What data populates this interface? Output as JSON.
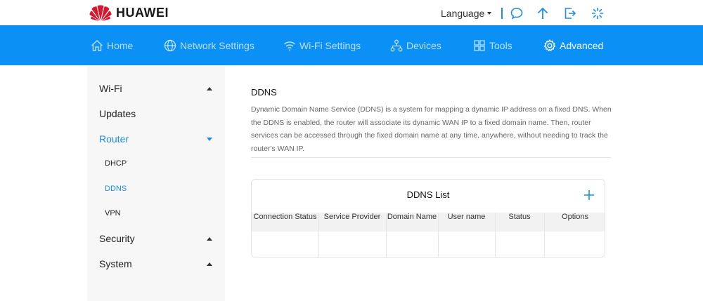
{
  "brand": {
    "name": "HUAWEI",
    "logo_icon": "huawei-petal-logo",
    "accent_color": "#0b90f5",
    "logo_color": "#d9162b"
  },
  "header": {
    "language_label": "Language",
    "icons": [
      "chat-bubble-icon",
      "arrow-up-icon",
      "logout-icon",
      "loading-spinner-icon"
    ]
  },
  "nav": {
    "items": [
      {
        "label": "Home",
        "icon": "home-icon"
      },
      {
        "label": "Network Settings",
        "icon": "globe-icon"
      },
      {
        "label": "Wi-Fi Settings",
        "icon": "wifi-icon"
      },
      {
        "label": "Devices",
        "icon": "devices-icon"
      },
      {
        "label": "Tools",
        "icon": "tools-icon"
      },
      {
        "label": "Advanced",
        "icon": "gear-icon",
        "active": true
      }
    ]
  },
  "sidebar": {
    "items": [
      {
        "label": "Wi-Fi"
      },
      {
        "label": "Updates"
      },
      {
        "label": "Router",
        "active": true
      },
      {
        "label": "Security"
      },
      {
        "label": "System"
      }
    ],
    "router_sub": [
      {
        "label": "DHCP"
      },
      {
        "label": "DDNS",
        "active": true
      },
      {
        "label": "VPN"
      }
    ]
  },
  "main": {
    "title": "DDNS",
    "description": "Dynamic Domain Name Service (DDNS) is a system for mapping a dynamic IP address on a fixed DNS. When the DDNS is enabled, the router will associate its dynamic WAN IP to a fixed domain name. Then, router services can be accessed through the fixed domain name at any time, anywhere, without needing to track the router's WAN IP.",
    "list": {
      "title": "DDNS List",
      "columns": [
        "Connection Status",
        "Service Provider",
        "Domain Name",
        "User name",
        "Status",
        "Options"
      ],
      "rows": []
    }
  }
}
